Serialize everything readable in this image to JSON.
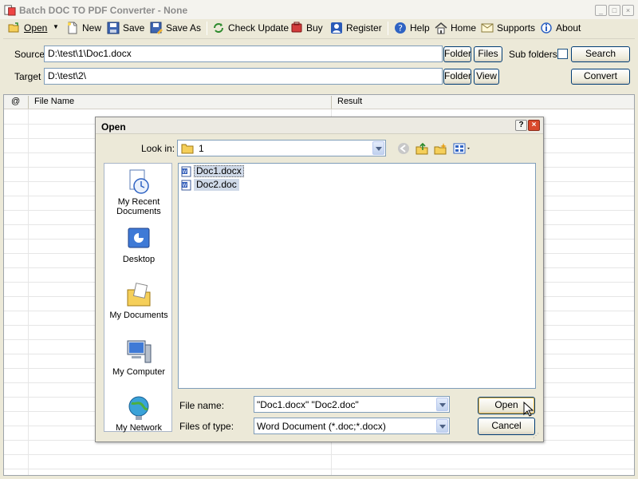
{
  "window": {
    "title": "Batch DOC TO PDF Converter - None"
  },
  "toolbar": {
    "items": [
      {
        "label": "Open",
        "icon": "open-folder-icon"
      },
      {
        "label": "New",
        "icon": "new-file-icon"
      },
      {
        "label": "Save",
        "icon": "save-disk-icon"
      },
      {
        "label": "Save As",
        "icon": "save-as-icon"
      },
      {
        "label": "Check Update",
        "icon": "refresh-icon"
      },
      {
        "label": "Buy",
        "icon": "cart-icon"
      },
      {
        "label": "Register",
        "icon": "register-icon"
      },
      {
        "label": "Help",
        "icon": "help-icon"
      },
      {
        "label": "Home",
        "icon": "home-icon"
      },
      {
        "label": "Supports",
        "icon": "supports-icon"
      },
      {
        "label": "About",
        "icon": "about-icon"
      }
    ]
  },
  "options": {
    "source_label": "Source",
    "source_value": "D:\\test\\1\\Doc1.docx",
    "target_label": "Target",
    "target_value": "D:\\test\\2\\",
    "folder_button": "Folder",
    "files_button": "Files",
    "view_button": "View",
    "subfolders_label": "Sub folders",
    "search_button": "Search",
    "convert_button": "Convert"
  },
  "grid": {
    "columns": [
      "@",
      "File Name",
      "Result"
    ]
  },
  "dialog": {
    "title": "Open",
    "look_in_label": "Look in:",
    "look_in_value": "1",
    "places": [
      "My Recent Documents",
      "Desktop",
      "My Documents",
      "My Computer",
      "My Network"
    ],
    "files": [
      "Doc1.docx",
      "Doc2.doc"
    ],
    "file_name_label": "File name:",
    "file_name_value": "\"Doc1.docx\" \"Doc2.doc\"",
    "file_type_label": "Files of type:",
    "file_type_value": "Word Document (*.doc;*.docx)",
    "open_button": "Open",
    "cancel_button": "Cancel"
  },
  "colors": {
    "accent": "#003c74",
    "window_bg": "#ece9d8",
    "close_red": "#d9492c"
  }
}
